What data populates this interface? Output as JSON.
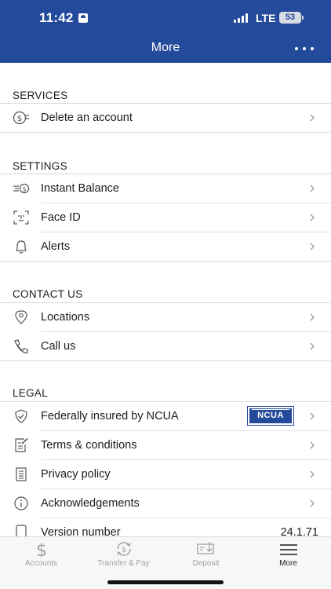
{
  "status_bar": {
    "time": "11:42",
    "network": "LTE",
    "battery": "53"
  },
  "header": {
    "title": "More"
  },
  "sections": {
    "services": {
      "title": "SERVICES",
      "items": [
        {
          "label": "Delete an account",
          "icon": "dollar-list-icon"
        }
      ]
    },
    "settings": {
      "title": "SETTINGS",
      "items": [
        {
          "label": "Instant Balance",
          "icon": "fast-dollar-icon"
        },
        {
          "label": "Face ID",
          "icon": "face-id-icon"
        },
        {
          "label": "Alerts",
          "icon": "bell-icon"
        }
      ]
    },
    "contact": {
      "title": "CONTACT US",
      "items": [
        {
          "label": "Locations",
          "icon": "location-pin-icon"
        },
        {
          "label": "Call us",
          "icon": "phone-icon"
        }
      ]
    },
    "legal": {
      "title": "LEGAL",
      "items": [
        {
          "label": "Federally insured by NCUA",
          "icon": "shield-check-icon",
          "badge": "NCUA"
        },
        {
          "label": "Terms & conditions",
          "icon": "document-edit-icon"
        },
        {
          "label": "Privacy policy",
          "icon": "document-lines-icon"
        },
        {
          "label": "Acknowledgements",
          "icon": "info-icon"
        },
        {
          "label": "Version number",
          "icon": "phone-device-icon",
          "value": "24.1.71"
        }
      ]
    }
  },
  "tabbar": {
    "tabs": [
      {
        "label": "Accounts",
        "icon": "dollar-icon",
        "active": false
      },
      {
        "label": "Transfer & Pay",
        "icon": "transfer-icon",
        "active": false
      },
      {
        "label": "Deposit",
        "icon": "check-deposit-icon",
        "active": false
      },
      {
        "label": "More",
        "icon": "menu-icon",
        "active": true
      }
    ]
  },
  "colors": {
    "brand": "#234a9b",
    "inactive_tab": "#a2a2a8"
  }
}
